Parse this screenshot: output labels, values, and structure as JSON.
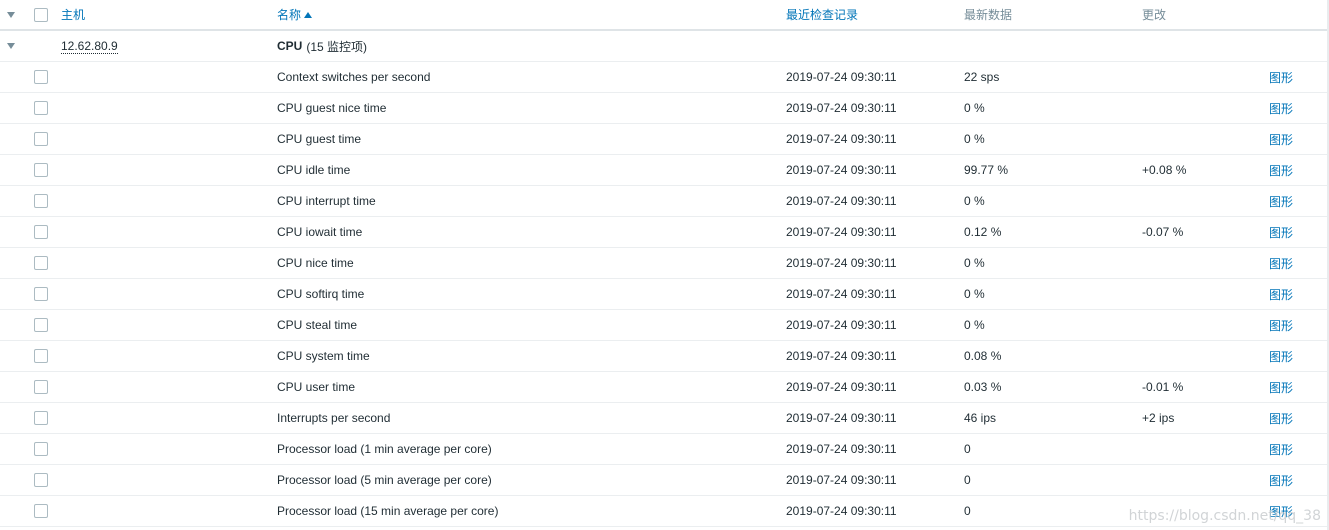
{
  "header": {
    "host_label": "主机",
    "name_label": "名称",
    "last_check_label": "最近检查记录",
    "latest_data_label": "最新数据",
    "change_label": "更改"
  },
  "group": {
    "host": "12.62.80.9",
    "name": "CPU",
    "count_text": "(15 监控项)"
  },
  "graph_link_label": "图形",
  "items": [
    {
      "name": "Context switches per second",
      "last_check": "2019-07-24 09:30:11",
      "latest": "22 sps",
      "change": ""
    },
    {
      "name": "CPU guest nice time",
      "last_check": "2019-07-24 09:30:11",
      "latest": "0 %",
      "change": ""
    },
    {
      "name": "CPU guest time",
      "last_check": "2019-07-24 09:30:11",
      "latest": "0 %",
      "change": ""
    },
    {
      "name": "CPU idle time",
      "last_check": "2019-07-24 09:30:11",
      "latest": "99.77 %",
      "change": "+0.08 %"
    },
    {
      "name": "CPU interrupt time",
      "last_check": "2019-07-24 09:30:11",
      "latest": "0 %",
      "change": ""
    },
    {
      "name": "CPU iowait time",
      "last_check": "2019-07-24 09:30:11",
      "latest": "0.12 %",
      "change": "-0.07 %"
    },
    {
      "name": "CPU nice time",
      "last_check": "2019-07-24 09:30:11",
      "latest": "0 %",
      "change": ""
    },
    {
      "name": "CPU softirq time",
      "last_check": "2019-07-24 09:30:11",
      "latest": "0 %",
      "change": ""
    },
    {
      "name": "CPU steal time",
      "last_check": "2019-07-24 09:30:11",
      "latest": "0 %",
      "change": ""
    },
    {
      "name": "CPU system time",
      "last_check": "2019-07-24 09:30:11",
      "latest": "0.08 %",
      "change": ""
    },
    {
      "name": "CPU user time",
      "last_check": "2019-07-24 09:30:11",
      "latest": "0.03 %",
      "change": "-0.01 %"
    },
    {
      "name": "Interrupts per second",
      "last_check": "2019-07-24 09:30:11",
      "latest": "46 ips",
      "change": "+2 ips"
    },
    {
      "name": "Processor load (1 min average per core)",
      "last_check": "2019-07-24 09:30:11",
      "latest": "0",
      "change": ""
    },
    {
      "name": "Processor load (5 min average per core)",
      "last_check": "2019-07-24 09:30:11",
      "latest": "0",
      "change": ""
    },
    {
      "name": "Processor load (15 min average per core)",
      "last_check": "2019-07-24 09:30:11",
      "latest": "0",
      "change": ""
    }
  ],
  "watermark": "https://blog.csdn.net/qq_38"
}
